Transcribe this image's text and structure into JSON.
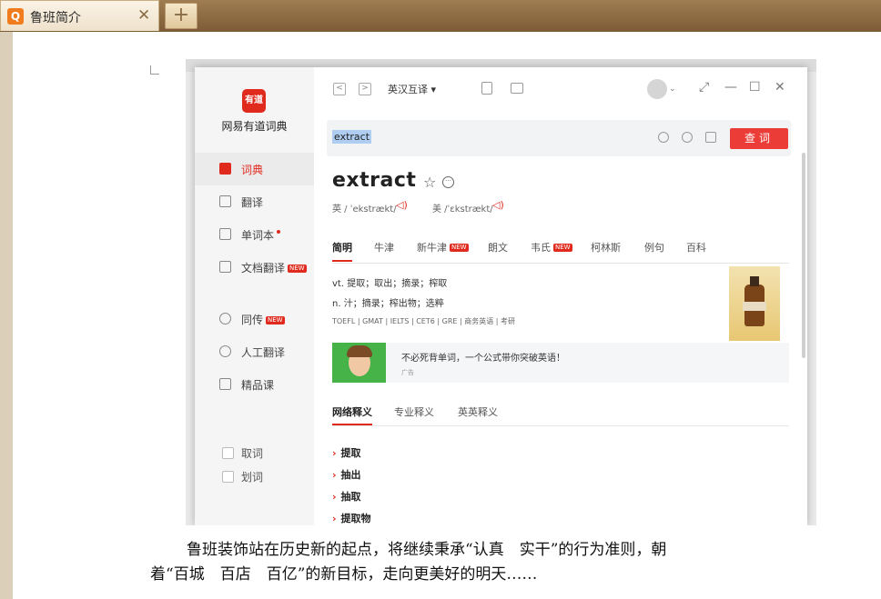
{
  "browser": {
    "tab_title": "鲁班简介",
    "tab_favicon": "Q",
    "tab_close": "✕",
    "new_tab": "+"
  },
  "youdao": {
    "app_name": "网易有道词典",
    "logo_text": "有道",
    "nav": [
      {
        "label": "词典",
        "icon": "dictionary-icon"
      },
      {
        "label": "翻译",
        "icon": "translate-icon"
      },
      {
        "label": "单词本",
        "icon": "wordbook-icon"
      },
      {
        "label": "文档翻译",
        "icon": "document-translate-icon",
        "badge": "NEW"
      },
      {
        "label": "同传",
        "icon": "simultaneous-icon",
        "badge": "NEW"
      },
      {
        "label": "人工翻译",
        "icon": "human-translate-icon"
      },
      {
        "label": "精品课",
        "icon": "course-icon"
      }
    ],
    "options": [
      "取词",
      "划词"
    ],
    "toolbar": {
      "back": "<",
      "forward": ">",
      "language": "英汉互译 ▾"
    },
    "search": {
      "value": "extract",
      "button": "查词"
    },
    "entry": {
      "word": "extract",
      "uk_label": "英 / ˈekstrækt/",
      "us_label": "美 /ˈɛkstrækt/",
      "tabs": [
        "简明",
        "牛津",
        "新牛津",
        "朗文",
        "韦氏",
        "柯林斯",
        "例句",
        "百科"
      ],
      "tab_badge": "NEW",
      "definitions": [
        "vt. 提取；取出；摘录；榨取",
        "n. 汁；摘录；榨出物；选粹"
      ],
      "exams": "TOEFL | GMAT | IELTS | CET6 | GRE | 商务英语 | 考研"
    },
    "ad": {
      "text": "不必死背单词，一个公式带你突破英语！",
      "label": "广告"
    },
    "web_tabs": [
      "网络释义",
      "专业释义",
      "英英释义"
    ],
    "web_defs": [
      "提取",
      "抽出",
      "抽取",
      "提取物"
    ]
  },
  "document": {
    "line1": "鲁班装饰站在历史新的起点，将继续秉承“认真　实干”的行为准则，朝",
    "line2": "着“百城　百店　百亿”的新目标，走向更美好的明天……"
  }
}
